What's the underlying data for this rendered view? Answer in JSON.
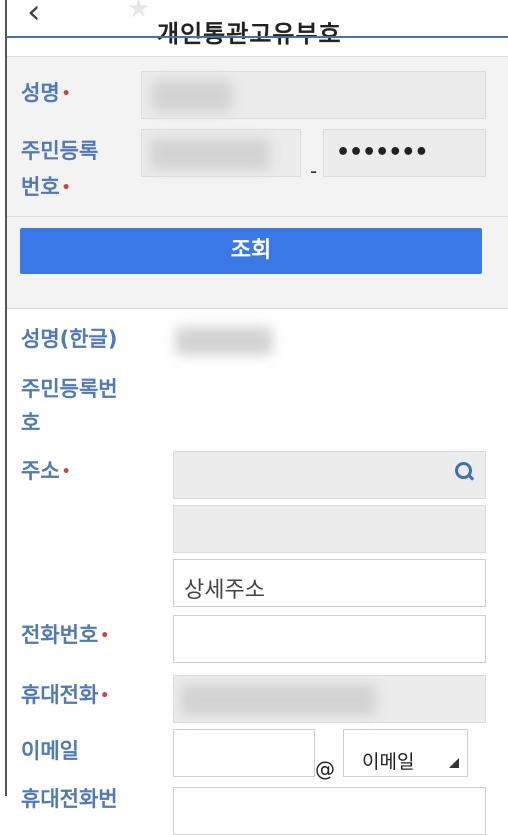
{
  "header": {
    "back_icon": "‹",
    "star_icon": "★",
    "title": "개인통관고유부호"
  },
  "lookup": {
    "name_label": "성명",
    "rrn_label_line1": "주민등록",
    "rrn_label_line2": "번호",
    "rrn_back_mask": "•••••••",
    "dash": "-",
    "required_mark": "•",
    "submit_label": "조회"
  },
  "result": {
    "name_kor_label": "성명(한글)",
    "rrn_label_line1": "주민등록번",
    "rrn_label_line2": "호",
    "address_label": "주소",
    "detail_address_placeholder": "상세주소",
    "phone_label": "전화번호",
    "mobile_label": "휴대전화",
    "email_label": "이메일",
    "email_at": "@",
    "email_domain_select": "이메일",
    "cutoff_label": "휴대전화번"
  },
  "colors": {
    "label_blue": "#4f79b8",
    "button_blue": "#3b78e7",
    "required_red": "#d0433d"
  }
}
